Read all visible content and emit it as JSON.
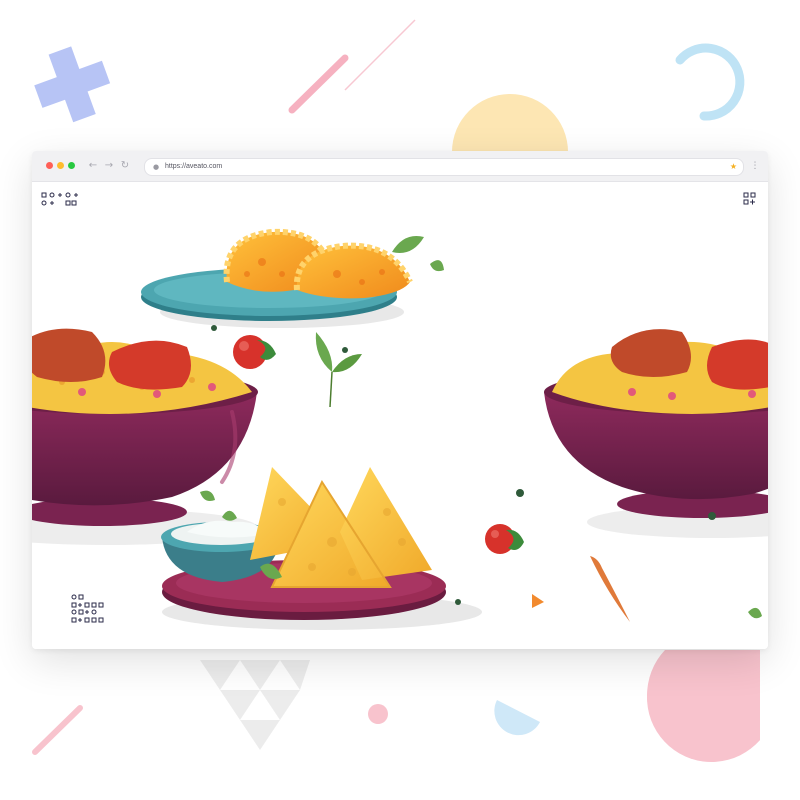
{
  "browser": {
    "url": "https://aveato.com",
    "window_controls": [
      "close",
      "minimize",
      "maximize"
    ],
    "nav_buttons": [
      "back",
      "forward",
      "reload"
    ]
  },
  "colors": {
    "close": "#ff5f57",
    "minimize": "#febc2e",
    "maximize": "#28c840",
    "bowl": "#7a2350",
    "plate_teal": "#4da6b0",
    "plate_maroon": "#9b2c55",
    "empanada": "#f5a623",
    "samosa": "#f6c945",
    "rice": "#f4c542"
  },
  "icons": {
    "back": "←",
    "forward": "→",
    "reload": "↻",
    "lock": "🔒",
    "star": "★",
    "menu": "⋮"
  }
}
